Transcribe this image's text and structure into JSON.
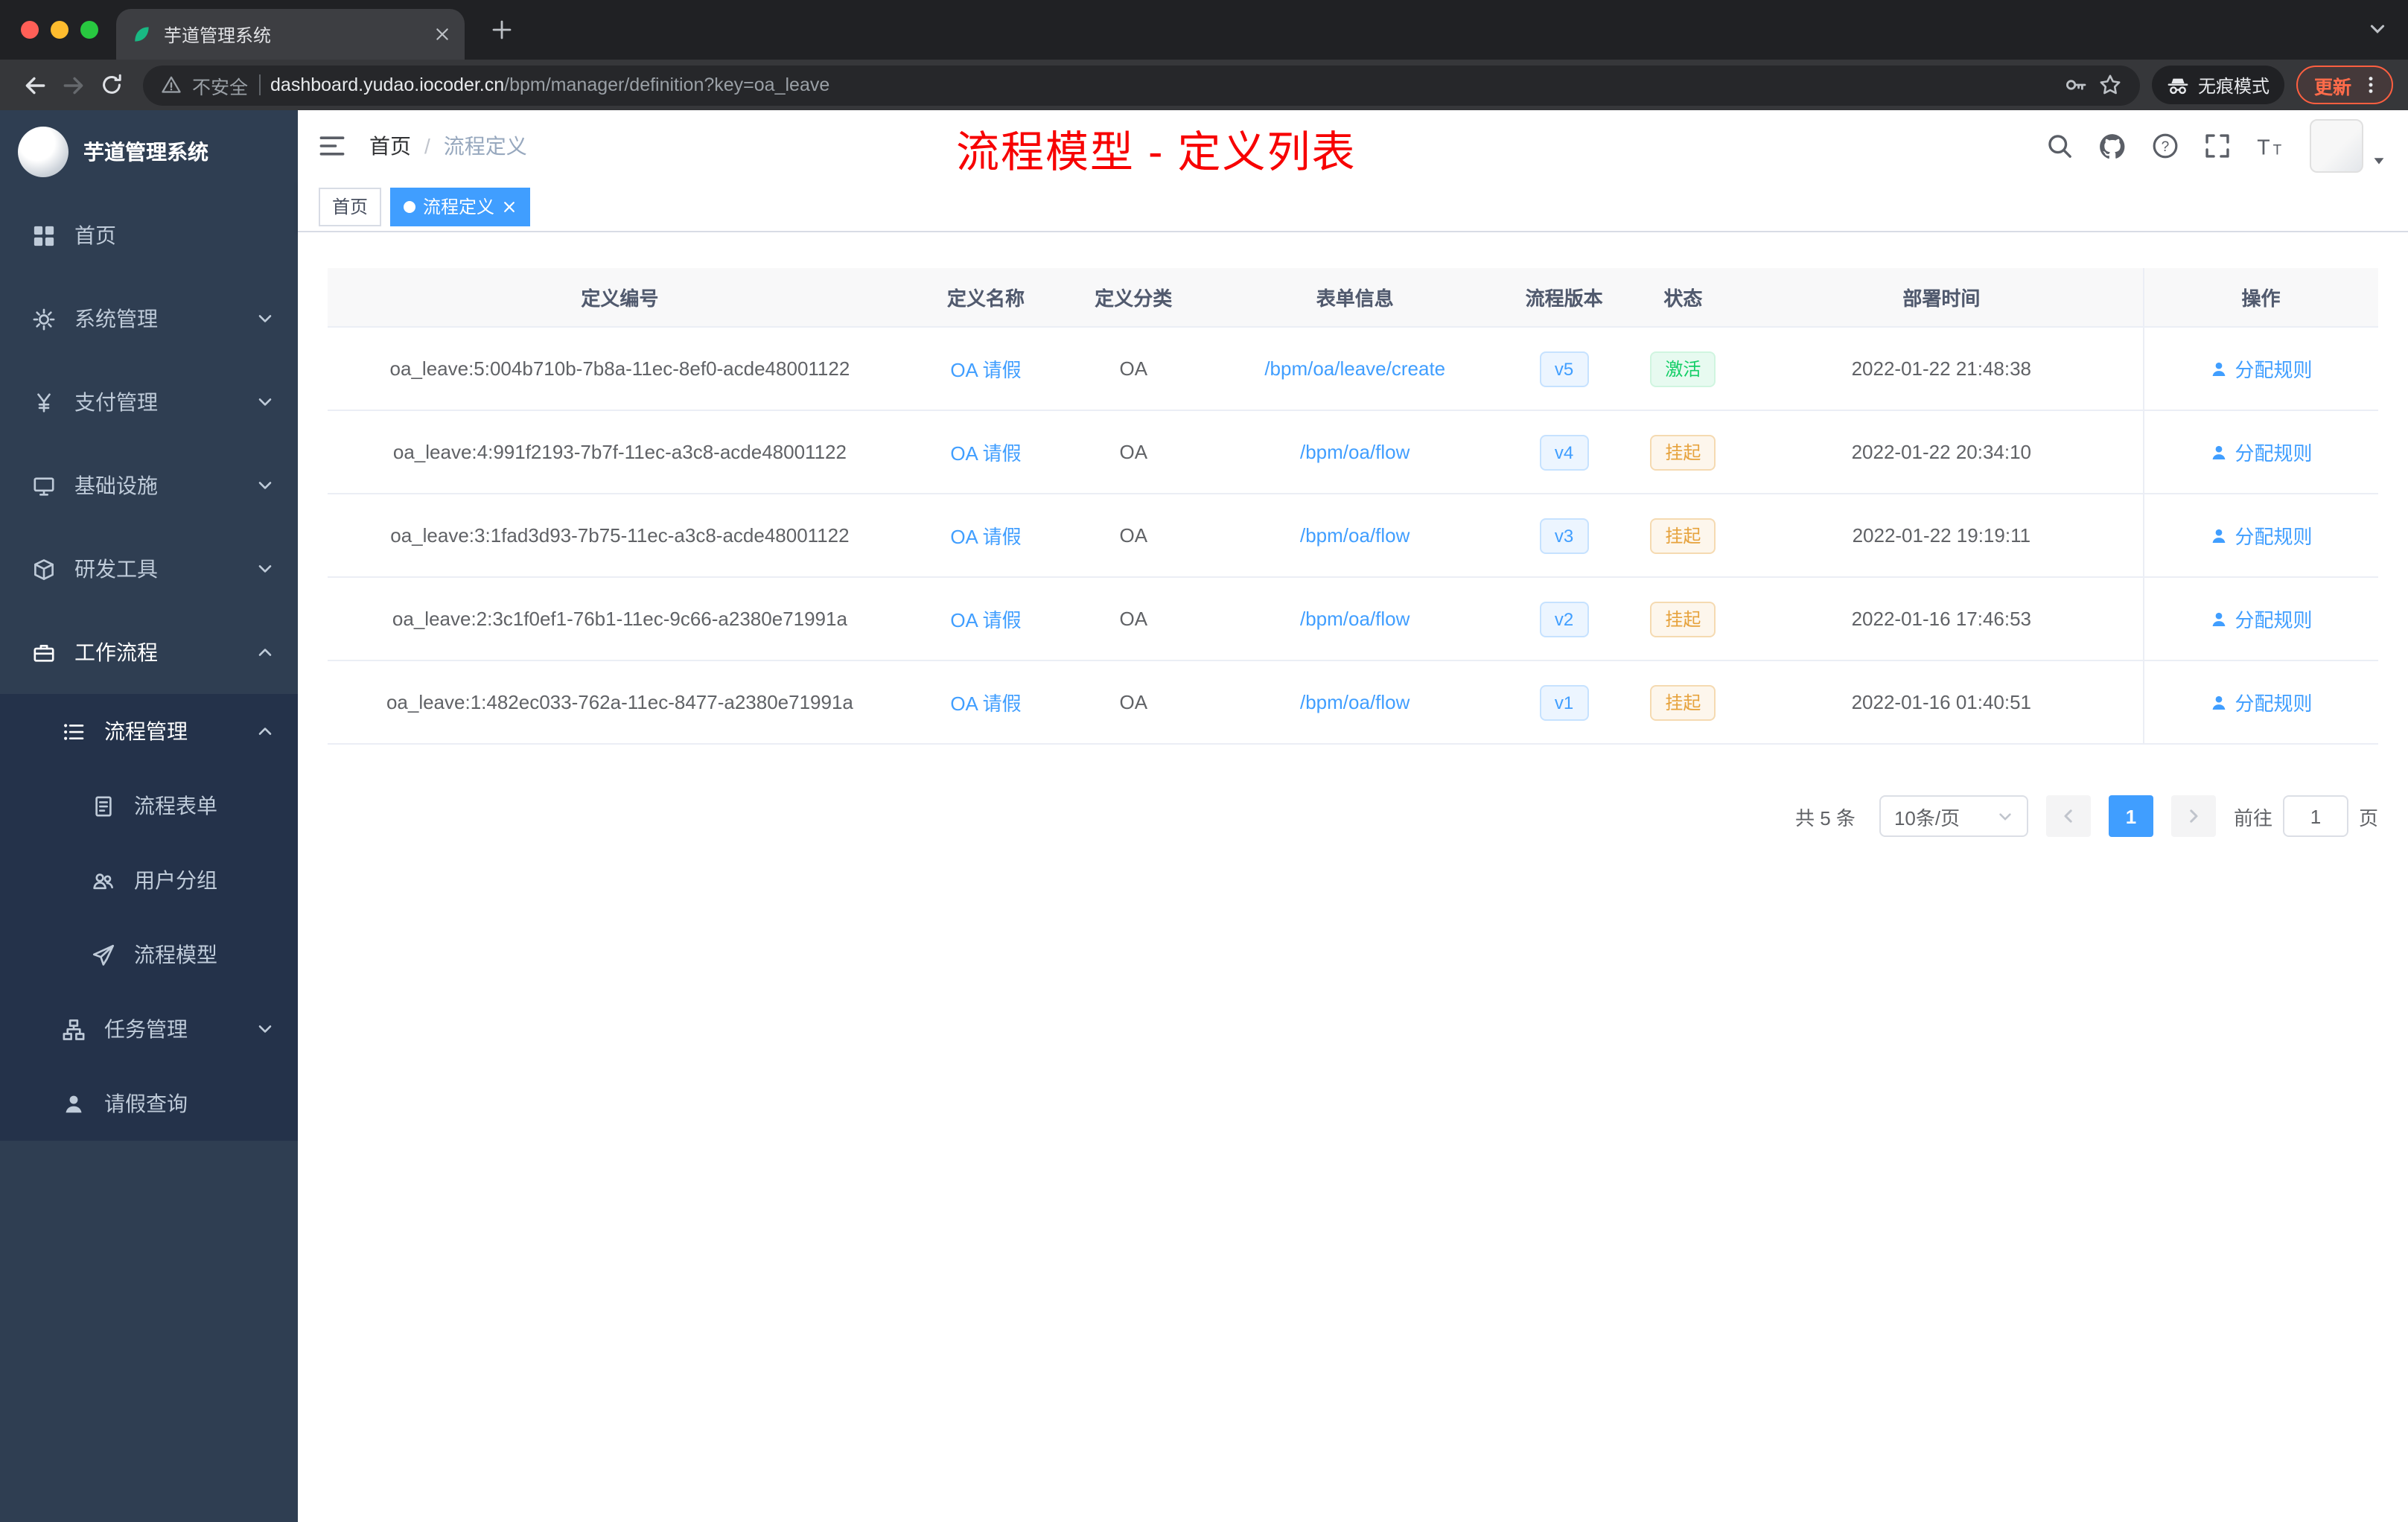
{
  "colors": {
    "primary": "#409eff",
    "success": "#13ce66",
    "warning": "#e6a23c",
    "annotation_red": "#f70000",
    "sidebar_bg": "#2f3e52",
    "submenu_bg": "#24324a",
    "tab_active_bg": "#409eff"
  },
  "browser": {
    "tab_title": "芋道管理系统",
    "security_label": "不安全",
    "url_host": "dashboard.yudao.iocoder.cn",
    "url_path": "/bpm/manager/definition?key=oa_leave",
    "incognito_label": "无痕模式",
    "update_label": "更新"
  },
  "sidebar": {
    "logo_title": "芋道管理系统",
    "items": [
      {
        "id": "home",
        "label": "首页",
        "icon": "home",
        "level": 1,
        "chevron": null,
        "sub": false,
        "active": false
      },
      {
        "id": "system",
        "label": "系统管理",
        "icon": "gear",
        "level": 1,
        "chevron": "down",
        "sub": false,
        "active": false
      },
      {
        "id": "payment",
        "label": "支付管理",
        "icon": "yen",
        "level": 1,
        "chevron": "down",
        "sub": false,
        "active": false
      },
      {
        "id": "infrastructure",
        "label": "基础设施",
        "icon": "infra",
        "level": 1,
        "chevron": "down",
        "sub": false,
        "active": false
      },
      {
        "id": "dev-tools",
        "label": "研发工具",
        "icon": "devtools",
        "level": 1,
        "chevron": "down",
        "sub": false,
        "active": false
      },
      {
        "id": "workflow",
        "label": "工作流程",
        "icon": "workflow",
        "level": 1,
        "chevron": "up",
        "sub": false,
        "active": true
      },
      {
        "id": "process-manage",
        "label": "流程管理",
        "icon": "process",
        "level": 2,
        "chevron": "up",
        "sub": true,
        "active": true
      },
      {
        "id": "process-form",
        "label": "流程表单",
        "icon": "doc",
        "level": 3,
        "chevron": null,
        "sub": true,
        "active": false
      },
      {
        "id": "user-group",
        "label": "用户分组",
        "icon": "group",
        "level": 3,
        "chevron": null,
        "sub": true,
        "active": false
      },
      {
        "id": "process-model",
        "label": "流程模型",
        "icon": "plane",
        "level": 3,
        "chevron": null,
        "sub": true,
        "active": false
      },
      {
        "id": "task-manage",
        "label": "任务管理",
        "icon": "tree",
        "level": 2,
        "chevron": "down",
        "sub": true,
        "active": false
      },
      {
        "id": "leave-query",
        "label": "请假查询",
        "icon": "user",
        "level": 2,
        "chevron": null,
        "sub": true,
        "active": false
      }
    ]
  },
  "navbar": {
    "breadcrumb": [
      "首页",
      "流程定义"
    ],
    "breadcrumb_separator": "/",
    "annotation_title": "流程模型 - 定义列表"
  },
  "tags_view": [
    {
      "label": "首页",
      "active": false,
      "closable": false
    },
    {
      "label": "流程定义",
      "active": true,
      "closable": true
    }
  ],
  "table": {
    "columns": [
      "定义编号",
      "定义名称",
      "定义分类",
      "表单信息",
      "流程版本",
      "状态",
      "部署时间",
      "操作"
    ],
    "action_label": "分配规则",
    "rows": [
      {
        "id": "oa_leave:5:004b710b-7b8a-11ec-8ef0-acde48001122",
        "name": "OA 请假",
        "category": "OA",
        "form": "/bpm/oa/leave/create",
        "version": "v5",
        "status": "激活",
        "status_type": "success",
        "time": "2022-01-22 21:48:38"
      },
      {
        "id": "oa_leave:4:991f2193-7b7f-11ec-a3c8-acde48001122",
        "name": "OA 请假",
        "category": "OA",
        "form": "/bpm/oa/flow",
        "version": "v4",
        "status": "挂起",
        "status_type": "warning",
        "time": "2022-01-22 20:34:10"
      },
      {
        "id": "oa_leave:3:1fad3d93-7b75-11ec-a3c8-acde48001122",
        "name": "OA 请假",
        "category": "OA",
        "form": "/bpm/oa/flow",
        "version": "v3",
        "status": "挂起",
        "status_type": "warning",
        "time": "2022-01-22 19:19:11"
      },
      {
        "id": "oa_leave:2:3c1f0ef1-76b1-11ec-9c66-a2380e71991a",
        "name": "OA 请假",
        "category": "OA",
        "form": "/bpm/oa/flow",
        "version": "v2",
        "status": "挂起",
        "status_type": "warning",
        "time": "2022-01-16 17:46:53"
      },
      {
        "id": "oa_leave:1:482ec033-762a-11ec-8477-a2380e71991a",
        "name": "OA 请假",
        "category": "OA",
        "form": "/bpm/oa/flow",
        "version": "v1",
        "status": "挂起",
        "status_type": "warning",
        "time": "2022-01-16 01:40:51"
      }
    ]
  },
  "pagination": {
    "total": "共 5 条",
    "page_size": "10条/页",
    "current_page": "1",
    "goto_label": "前往",
    "goto_value": "1",
    "page_unit": "页"
  }
}
